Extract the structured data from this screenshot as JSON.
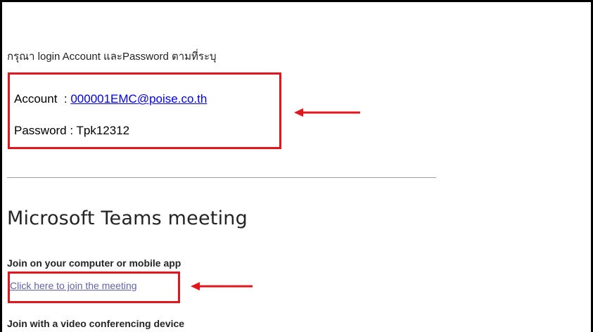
{
  "email": {
    "intro_text": "กรุณา login Account และPassword ตามที่ระบุ",
    "account_label": "Account  : ",
    "account_value": "000001EMC@poise.co.th",
    "password_label": "Password : ",
    "password_value": "Tpk12312"
  },
  "teams": {
    "title": "Microsoft Teams meeting",
    "join_heading": "Join on your computer or mobile app",
    "join_link": "Click here to join the meeting",
    "video_heading": "Join with a video conferencing device"
  },
  "annotations": {
    "highlight_color": "#e3161e",
    "arrow_icon": "left-arrow-icon"
  },
  "colors": {
    "email_link": "#0000ee",
    "teams_link": "#6264a7",
    "divider": "#a0a0a0"
  }
}
